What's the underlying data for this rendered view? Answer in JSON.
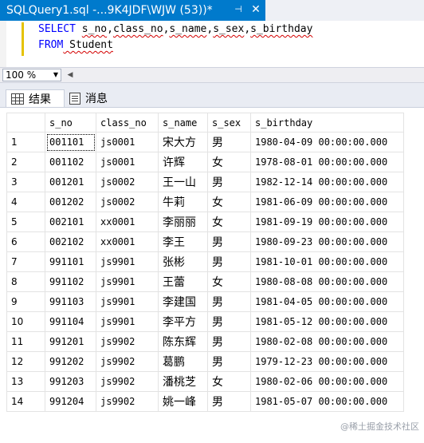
{
  "tab": {
    "title": "SQLQuery1.sql -...9K4JDF\\WJW (53))*",
    "pin_glyph": "⊣",
    "close_glyph": "✕"
  },
  "editor": {
    "line1": {
      "keyword": "SELECT",
      "rest": [
        " ",
        "s_no",
        ",",
        "class_no",
        ",",
        "s_name",
        ",",
        "s_sex",
        ",",
        "s_birthday"
      ]
    },
    "line2": {
      "keyword": "FROM",
      "rest": " Student"
    }
  },
  "zoom": {
    "value": "100 %"
  },
  "results_tabs": [
    {
      "label": "结果",
      "icon": "grid-icon"
    },
    {
      "label": "消息",
      "icon": "message-icon"
    }
  ],
  "grid": {
    "columns": [
      "s_no",
      "class_no",
      "s_name",
      "s_sex",
      "s_birthday"
    ],
    "rows": [
      [
        "1",
        "001101",
        "js0001",
        "宋大方",
        "男",
        "1980-04-09 00:00:00.000"
      ],
      [
        "2",
        "001102",
        "js0001",
        "许辉",
        "女",
        "1978-08-01 00:00:00.000"
      ],
      [
        "3",
        "001201",
        "js0002",
        "王一山",
        "男",
        "1982-12-14 00:00:00.000"
      ],
      [
        "4",
        "001202",
        "js0002",
        "牛莉",
        "女",
        "1981-06-09 00:00:00.000"
      ],
      [
        "5",
        "002101",
        "xx0001",
        "李丽丽",
        "女",
        "1981-09-19 00:00:00.000"
      ],
      [
        "6",
        "002102",
        "xx0001",
        "李王",
        "男",
        "1980-09-23 00:00:00.000"
      ],
      [
        "7",
        "991101",
        "js9901",
        "张彬",
        "男",
        "1981-10-01 00:00:00.000"
      ],
      [
        "8",
        "991102",
        "js9901",
        "王蕾",
        "女",
        "1980-08-08 00:00:00.000"
      ],
      [
        "9",
        "991103",
        "js9901",
        "李建国",
        "男",
        "1981-04-05 00:00:00.000"
      ],
      [
        "10",
        "991104",
        "js9901",
        "李平方",
        "男",
        "1981-05-12 00:00:00.000"
      ],
      [
        "11",
        "991201",
        "js9902",
        "陈东辉",
        "男",
        "1980-02-08 00:00:00.000"
      ],
      [
        "12",
        "991202",
        "js9902",
        "葛鹏",
        "男",
        "1979-12-23 00:00:00.000"
      ],
      [
        "13",
        "991203",
        "js9902",
        "潘桃芝",
        "女",
        "1980-02-06 00:00:00.000"
      ],
      [
        "14",
        "991204",
        "js9902",
        "姚一峰",
        "男",
        "1981-05-07 00:00:00.000"
      ]
    ]
  },
  "watermark": "@稀土掘金技术社区"
}
